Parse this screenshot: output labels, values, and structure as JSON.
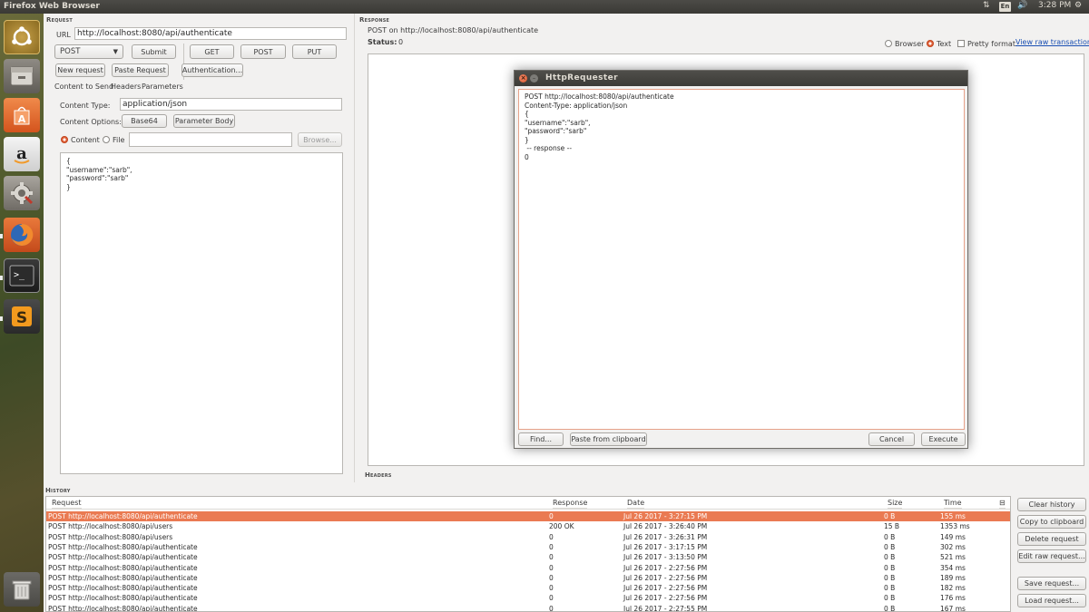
{
  "window": {
    "title": "Firefox Web Browser"
  },
  "topbar": {
    "keyboard_layout": "En",
    "time": "3:28 PM"
  },
  "launcher": {
    "items": [
      {
        "name": "dash-home-icon"
      },
      {
        "name": "files-icon"
      },
      {
        "name": "software-center-icon"
      },
      {
        "name": "amazon-icon"
      },
      {
        "name": "system-settings-icon"
      },
      {
        "name": "firefox-icon"
      },
      {
        "name": "terminal-icon"
      },
      {
        "name": "sublime-text-icon"
      },
      {
        "name": "trash-icon"
      }
    ]
  },
  "request": {
    "header": "Request",
    "url_label": "URL",
    "url_value": "http://localhost:8080/api/authenticate",
    "method": "POST",
    "submit_label": "Submit",
    "get_label": "GET",
    "post_label": "POST",
    "put_label": "PUT",
    "new_request_label": "New request",
    "paste_request_label": "Paste Request",
    "authentication_label": "Authentication...",
    "tabs": [
      "Content to Send",
      "Headers",
      "Parameters"
    ],
    "content_type_label": "Content Type:",
    "content_type_value": "application/json",
    "content_options_label": "Content Options:",
    "base64_label": "Base64",
    "parameter_body_label": "Parameter Body",
    "content_radio_label": "Content",
    "file_radio_label": "File",
    "browse_label": "Browse...",
    "body": "{\n\"username\":\"sarb\",\n\"password\":\"sarb\"\n}"
  },
  "response": {
    "header": "Response",
    "summary": "POST on http://localhost:8080/api/authenticate",
    "status_label": "Status:",
    "status_value": "0",
    "browser_label": "Browser",
    "text_label": "Text",
    "pretty_format_label": "Pretty format",
    "view_raw_label": "View raw transaction",
    "headers_header": "Headers"
  },
  "dialog": {
    "title": "HttpRequester",
    "content": "POST http://localhost:8080/api/authenticate\nContent-Type: application/json\n{\n\"username\":\"sarb\",\n\"password\":\"sarb\"\n}\n -- response --\n0",
    "find_label": "Find...",
    "paste_clipboard_label": "Paste from clipboard",
    "cancel_label": "Cancel",
    "execute_label": "Execute"
  },
  "history": {
    "header": "History",
    "columns": [
      "Request",
      "Response",
      "Date",
      "Size",
      "Time"
    ],
    "rows": [
      [
        "POST http://localhost:8080/api/authenticate",
        "0",
        "Jul 26 2017 - 3:27:15 PM",
        "0 B",
        "155 ms"
      ],
      [
        "POST http://localhost:8080/api/users",
        "200 OK",
        "Jul 26 2017 - 3:26:40 PM",
        "15 B",
        "1353 ms"
      ],
      [
        "POST http://localhost:8080/api/users",
        "0",
        "Jul 26 2017 - 3:26:31 PM",
        "0 B",
        "149 ms"
      ],
      [
        "POST http://localhost:8080/api/authenticate",
        "0",
        "Jul 26 2017 - 3:17:15 PM",
        "0 B",
        "302 ms"
      ],
      [
        "POST http://localhost:8080/api/authenticate",
        "0",
        "Jul 26 2017 - 3:13:50 PM",
        "0 B",
        "521 ms"
      ],
      [
        "POST http://localhost:8080/api/authenticate",
        "0",
        "Jul 26 2017 - 2:27:56 PM",
        "0 B",
        "354 ms"
      ],
      [
        "POST http://localhost:8080/api/authenticate",
        "0",
        "Jul 26 2017 - 2:27:56 PM",
        "0 B",
        "189 ms"
      ],
      [
        "POST http://localhost:8080/api/authenticate",
        "0",
        "Jul 26 2017 - 2:27:56 PM",
        "0 B",
        "182 ms"
      ],
      [
        "POST http://localhost:8080/api/authenticate",
        "0",
        "Jul 26 2017 - 2:27:56 PM",
        "0 B",
        "176 ms"
      ],
      [
        "POST http://localhost:8080/api/authenticate",
        "0",
        "Jul 26 2017 - 2:27:55 PM",
        "0 B",
        "167 ms"
      ]
    ],
    "selected_row": 0,
    "buttons": {
      "clear": "Clear history",
      "copy": "Copy to clipboard",
      "delete": "Delete request",
      "edit_raw": "Edit raw request...",
      "save": "Save request...",
      "load": "Load request..."
    }
  },
  "colors": {
    "accent": "#ea7a52",
    "link": "#1a4fb3",
    "panel": "#3c3b37"
  }
}
